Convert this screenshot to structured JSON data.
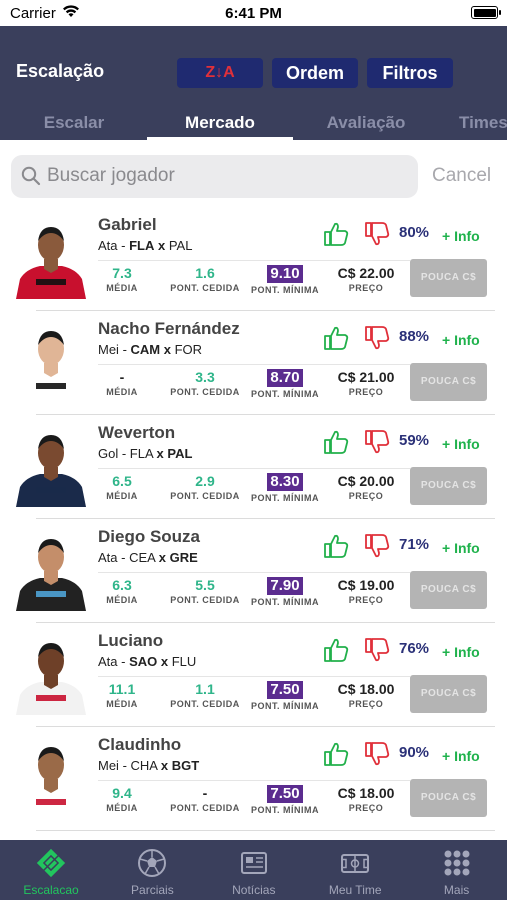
{
  "status_bar": {
    "carrier": "Carrier",
    "time": "6:41 PM"
  },
  "header": {
    "title": "Escalação",
    "sort_label": "Z↓A",
    "order_label": "Ordem",
    "filters_label": "Filtros",
    "tabs": [
      "Escalar",
      "Mercado",
      "Avaliação",
      "Times"
    ],
    "active_tab": "Mercado"
  },
  "search": {
    "placeholder": "Buscar jogador",
    "value": "",
    "cancel_label": "Cancel"
  },
  "stat_labels": {
    "media": "MÉDIA",
    "cedida": "PONT. CEDIDA",
    "minima": "PONT. MÍNIMA",
    "preco": "PREÇO"
  },
  "buy_label": "POUCA C$",
  "more_label": "+ Info",
  "players": [
    {
      "name": "Gabriel",
      "pos": "Ata",
      "home": "FLA",
      "sep": "x",
      "away": "PAL",
      "bold_side": "home",
      "media": "7.3",
      "cedida": "1.6",
      "minima": "9.10",
      "preco": "C$ 22.00",
      "pct": "80%",
      "kit": "#c8102e",
      "kit2": "#111111",
      "skin": "#8a5a3c"
    },
    {
      "name": "Nacho Fernández",
      "pos": "Mei",
      "home": "CAM",
      "sep": "x",
      "away": "FOR",
      "bold_side": "home",
      "media": "-",
      "cedida": "3.3",
      "minima": "8.70",
      "preco": "C$ 21.00",
      "pct": "88%",
      "kit": "#ffffff",
      "kit2": "#111111",
      "skin": "#e0b596"
    },
    {
      "name": "Weverton",
      "pos": "Gol",
      "home": "FLA",
      "sep": "x",
      "away": "PAL",
      "bold_side": "away",
      "media": "6.5",
      "cedida": "2.9",
      "minima": "8.30",
      "preco": "C$ 20.00",
      "pct": "59%",
      "kit": "#1a2a4a",
      "kit2": "#1a2a4a",
      "skin": "#7a4a30"
    },
    {
      "name": "Diego Souza",
      "pos": "Ata",
      "home": "CEA",
      "sep": "x",
      "away": "GRE",
      "bold_side": "away",
      "media": "6.3",
      "cedida": "5.5",
      "minima": "7.90",
      "preco": "C$ 19.00",
      "pct": "71%",
      "kit": "#222222",
      "kit2": "#4fa3d6",
      "skin": "#c48e6a"
    },
    {
      "name": "Luciano",
      "pos": "Ata",
      "home": "SAO",
      "sep": "x",
      "away": "FLU",
      "bold_side": "home",
      "media": "11.1",
      "cedida": "1.1",
      "minima": "7.50",
      "preco": "C$ 18.00",
      "pct": "76%",
      "kit": "#f2f2f2",
      "kit2": "#c8102e",
      "skin": "#6e4028"
    },
    {
      "name": "Claudinho",
      "pos": "Mei",
      "home": "CHA",
      "sep": "x",
      "away": "BGT",
      "bold_side": "away",
      "media": "9.4",
      "cedida": "-",
      "minima": "7.50",
      "preco": "C$ 18.00",
      "pct": "90%",
      "kit": "#ffffff",
      "kit2": "#c8102e",
      "skin": "#9a6a48"
    }
  ],
  "tabbar": [
    {
      "label": "Escalacao",
      "icon": "field-badge-icon",
      "active": true
    },
    {
      "label": "Parciais",
      "icon": "soccer-ball-icon",
      "active": false
    },
    {
      "label": "Notícias",
      "icon": "newspaper-icon",
      "active": false
    },
    {
      "label": "Meu Time",
      "icon": "pitch-icon",
      "active": false
    },
    {
      "label": "Mais",
      "icon": "grid-dots-icon",
      "active": false
    }
  ],
  "colors": {
    "header_bg": "#3a3f5c",
    "button_bg": "#1f2a70",
    "accent_green": "#1fb24c",
    "minima_bg": "#5b2c8f",
    "pct_color": "#2b3178"
  }
}
